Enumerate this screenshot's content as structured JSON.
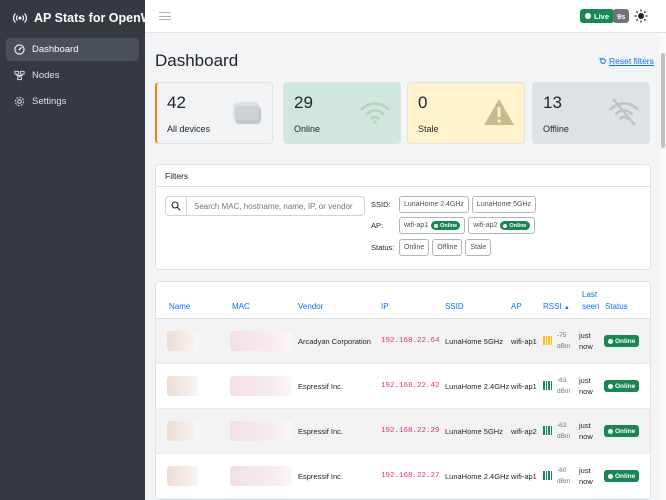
{
  "app": {
    "title": "AP Stats for OpenWrt"
  },
  "sidebar": {
    "items": [
      {
        "label": "Dashboard",
        "icon": "gauge-icon",
        "active": true
      },
      {
        "label": "Nodes",
        "icon": "nodes-icon",
        "active": false
      },
      {
        "label": "Settings",
        "icon": "gear-icon",
        "active": false
      }
    ]
  },
  "topbar": {
    "live_label": "Live",
    "refresh_label": "9s"
  },
  "main": {
    "title": "Dashboard",
    "reset_label": "Reset filters"
  },
  "cards": [
    {
      "value": "42",
      "label": "All devices"
    },
    {
      "value": "29",
      "label": "Online"
    },
    {
      "value": "0",
      "label": "Stale"
    },
    {
      "value": "13",
      "label": "Offline"
    }
  ],
  "filters": {
    "title": "Filters",
    "search_placeholder": "Search MAC, hostname, name, IP, or vendor",
    "ssid_label": "SSID:",
    "ssids": [
      "LunaHome 2.4GHz",
      "LunaHome 5GHz"
    ],
    "ap_label": "AP:",
    "aps": [
      {
        "name": "wifi-ap1",
        "status": "Online"
      },
      {
        "name": "wifi-ap2",
        "status": "Online"
      }
    ],
    "status_label": "Status:",
    "statuses": [
      "Online",
      "Offline",
      "Stale"
    ]
  },
  "table": {
    "headers": {
      "name": "Name",
      "mac": "MAC",
      "vendor": "Vendor",
      "ip": "IP",
      "ssid": "SSID",
      "ap": "AP",
      "rssi": "RSSI",
      "last_seen_1": "Last",
      "last_seen_2": "seen",
      "status": "Status"
    },
    "rows": [
      {
        "vendor": "Arcadyan Corporation",
        "ip": "192.168.22.64",
        "ssid": "LunaHome 5GHz",
        "ap": "wifi-ap1",
        "rssi_num": "-75",
        "rssi_unit": "dBm",
        "signal_color": "#ffc107",
        "last_1": "just",
        "last_2": "now",
        "status": "Online"
      },
      {
        "vendor": "Espressif Inc.",
        "ip": "192.168.22.42",
        "ssid": "LunaHome 2.4GHz",
        "ap": "wifi-ap1",
        "rssi_num": "-63",
        "rssi_unit": "dBm",
        "signal_color": "#198754",
        "last_1": "just",
        "last_2": "now",
        "status": "Online"
      },
      {
        "vendor": "Espressif Inc.",
        "ip": "192.168.22.29",
        "ssid": "LunaHome 5GHz",
        "ap": "wifi-ap2",
        "rssi_num": "-63",
        "rssi_unit": "dBm",
        "signal_color": "#198754",
        "last_1": "just",
        "last_2": "now",
        "status": "Online"
      },
      {
        "vendor": "Espressif Inc.",
        "ip": "192.168.22.27",
        "ssid": "LunaHome 2.4GHz",
        "ap": "wifi-ap1",
        "rssi_num": "-60",
        "rssi_unit": "dBm",
        "signal_color": "#198754",
        "last_1": "just",
        "last_2": "now",
        "status": "Online"
      }
    ]
  },
  "colors": {
    "accent": "#0d6efd",
    "success": "#198754",
    "sidebar_bg": "#343a40"
  }
}
